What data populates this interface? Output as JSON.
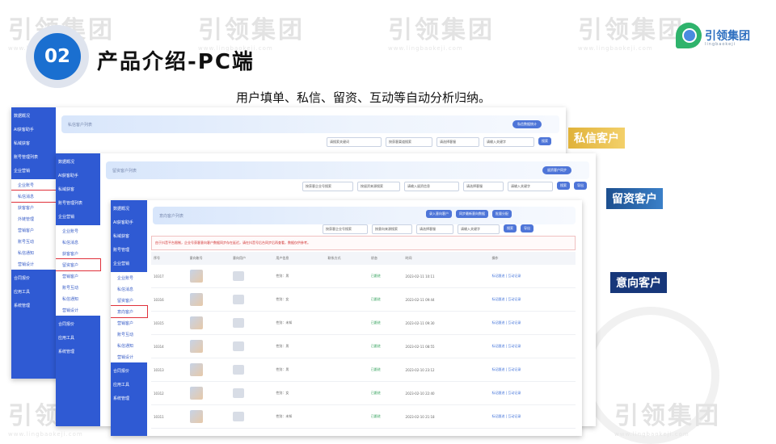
{
  "header": {
    "section_number": "02",
    "title": "产品介绍-PC端",
    "subtitle": "用户填单、私信、留资、互动等自动分析归纳。"
  },
  "logo": {
    "name": "引领集团",
    "sub": "lingbaokeji"
  },
  "watermark": {
    "text": "引领集团",
    "sub": "www.lingbaokeji.com"
  },
  "tags": {
    "private": "私信客户",
    "retained": "留资客户",
    "intent": "意向客户"
  },
  "colors": {
    "accent": "#1a6fd0",
    "sidebar": "#2f5ad3",
    "gold": "#e0b23a",
    "navy": "#17377a"
  },
  "screens": {
    "s1": {
      "sidebar": [
        "数据概况",
        "AI获客助手",
        "私域获客",
        "账号管理列表",
        "企业营销",
        "企业账号",
        "私信消息",
        "获客客户",
        "外链管理",
        "营销客户",
        "账号互动",
        "私信通知",
        "营销设计",
        "合同报价",
        "应用工具",
        "系统管理"
      ],
      "banner": "私信客户列表",
      "pill": "私信数据统计",
      "filters": [
        "请搜索关键词",
        "按获客渠道搜索",
        "请选择客服",
        "请输入关键字"
      ],
      "search": "搜索"
    },
    "s2": {
      "sidebar": [
        "数据概况",
        "AI获客助手",
        "私域获客",
        "账号管理列表",
        "企业营销",
        "企业账号",
        "私信消息",
        "获客客户",
        "留资客户",
        "营销客户",
        "账号互动",
        "私信通知",
        "营销设计",
        "合同报价",
        "应用工具",
        "系统管理"
      ],
      "banner": "留资客户列表",
      "pill": "留资客户同步",
      "filters": [
        "按获客企业号搜索",
        "按留资来源搜索",
        "请输入留资信息",
        "请选择客服",
        "请输入关键字"
      ],
      "search": "搜索",
      "export": "导出"
    },
    "s3": {
      "sidebar": [
        "数据概况",
        "AI获客助手",
        "私域获客",
        "账号管理",
        "企业营销",
        "企业账号",
        "私信消息",
        "留资客户",
        "意向客户",
        "营销客户",
        "账号互动",
        "私信通知",
        "营销设计",
        "合同报价",
        "应用工具",
        "系统管理"
      ],
      "banner": "意向客户列表",
      "buttons": [
        "录入意向客户",
        "同步最新意向数据",
        "批量分配"
      ],
      "filters": [
        "按获客企业号搜索",
        "按意向来源搜索",
        "请选择客服",
        "请输入关键字"
      ],
      "search": "搜索",
      "export": "导出",
      "notice": "由于抖音平台限制，企业号获客意向客户数据同步存在延迟，请在抖音号后台同步后再查看，数据仅供参考。",
      "columns": [
        "序号",
        "意向账号",
        "意向用户",
        "用户信息",
        "联系方式",
        "状态",
        "时间",
        "操作"
      ],
      "rows": [
        {
          "id": "10317",
          "info": "性别：男",
          "status": "已跟进",
          "time": "2023-02-11 10:11",
          "ops": "标记跟进 | 互动记录"
        },
        {
          "id": "10316",
          "info": "性别：女",
          "status": "已跟进",
          "time": "2023-02-11 09:44",
          "ops": "标记跟进 | 互动记录"
        },
        {
          "id": "10315",
          "info": "性别：未知",
          "status": "已跟进",
          "time": "2023-02-11 09:30",
          "ops": "标记跟进 | 互动记录"
        },
        {
          "id": "10314",
          "info": "性别：男",
          "status": "已跟进",
          "time": "2023-02-11 08:55",
          "ops": "标记跟进 | 互动记录"
        },
        {
          "id": "10313",
          "info": "性别：男",
          "status": "已跟进",
          "time": "2023-02-10 23:12",
          "ops": "标记跟进 | 互动记录"
        },
        {
          "id": "10312",
          "info": "性别：女",
          "status": "已跟进",
          "time": "2023-02-10 22:40",
          "ops": "标记跟进 | 互动记录"
        },
        {
          "id": "10311",
          "info": "性别：未知",
          "status": "已跟进",
          "time": "2023-02-10 21:18",
          "ops": "标记跟进 | 互动记录"
        }
      ]
    }
  }
}
